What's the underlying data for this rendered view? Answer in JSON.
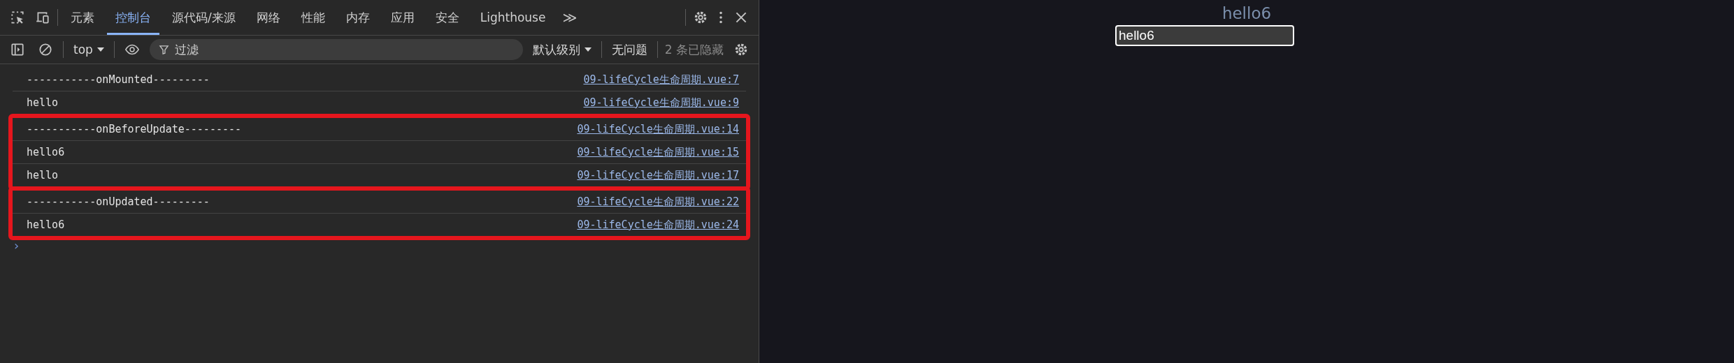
{
  "devtools": {
    "tabs": [
      {
        "label": "元素",
        "selected": false
      },
      {
        "label": "控制台",
        "selected": true
      },
      {
        "label": "源代码/来源",
        "selected": false
      },
      {
        "label": "网络",
        "selected": false
      },
      {
        "label": "性能",
        "selected": false
      },
      {
        "label": "内存",
        "selected": false
      },
      {
        "label": "应用",
        "selected": false
      },
      {
        "label": "安全",
        "selected": false
      },
      {
        "label": "Lighthouse",
        "selected": false
      }
    ],
    "more_tabs": "≫",
    "console_toolbar": {
      "context": "top",
      "filter": {
        "placeholder": "过滤"
      },
      "level": "默认级别",
      "issues": "无问题",
      "hidden": "2 条已隐藏"
    },
    "groups": [
      {
        "highlighted": false,
        "entries": [
          {
            "message": "-----------onMounted---------",
            "source": "09-lifeCycle生命周期.vue:7"
          },
          {
            "message": "hello",
            "source": "09-lifeCycle生命周期.vue:9"
          }
        ]
      },
      {
        "highlighted": true,
        "entries": [
          {
            "message": "-----------onBeforeUpdate---------",
            "source": "09-lifeCycle生命周期.vue:14"
          },
          {
            "message": "hello6",
            "source": "09-lifeCycle生命周期.vue:15"
          },
          {
            "message": "hello",
            "source": "09-lifeCycle生命周期.vue:17"
          }
        ]
      },
      {
        "highlighted": true,
        "entries": [
          {
            "message": "-----------onUpdated---------",
            "source": "09-lifeCycle生命周期.vue:22"
          },
          {
            "message": "hello6",
            "source": "09-lifeCycle生命周期.vue:24"
          }
        ]
      }
    ],
    "prompt": "›"
  },
  "page": {
    "heading": "hello6",
    "input_value": "hello6"
  }
}
